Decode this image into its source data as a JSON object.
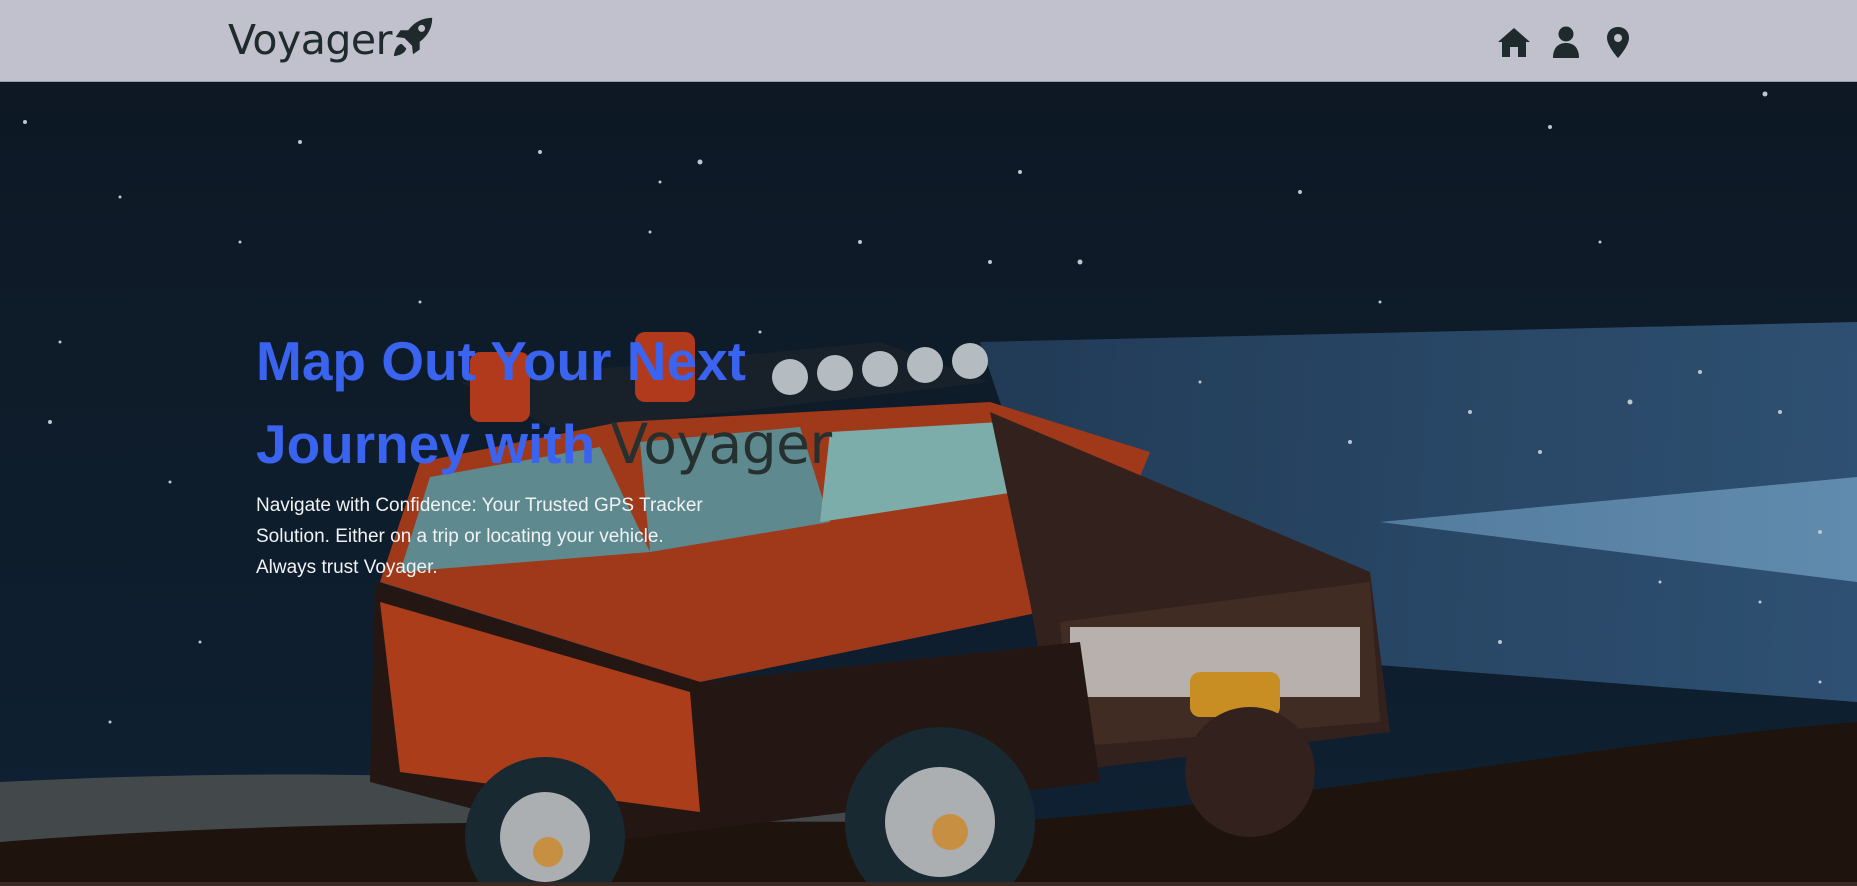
{
  "navbar": {
    "brand_name": "Voyager",
    "brand_icon": "rocket-icon",
    "background": "#c0c1cc",
    "icons": [
      {
        "name": "home-icon"
      },
      {
        "name": "user-icon"
      },
      {
        "name": "location-pin-icon"
      }
    ]
  },
  "hero": {
    "title_line1": "Map Out Your Next",
    "title_line2_prefix": "Journey with",
    "title_brand": "Voyager",
    "description": "Navigate with Confidence: Your Trusted GPS Tracker Solution. Either on a trip or locating your vehicle. Always trust Voyager.",
    "title_color": "#3a64f0",
    "background_art": "night-offroad-truck-illustration"
  }
}
